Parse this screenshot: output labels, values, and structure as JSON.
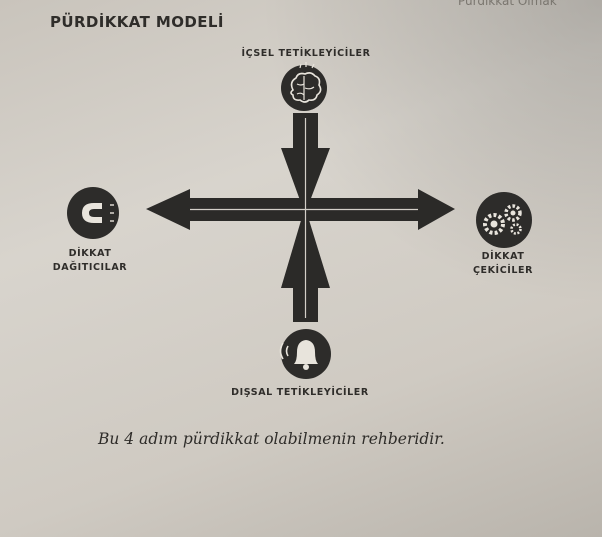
{
  "page": {
    "running_head": "Pürdikkat Olmak",
    "title": "PÜRDİKKAT MODELİ",
    "caption": "Bu 4 adım pürdikkat olabilmenin rehberidir."
  },
  "diagram": {
    "nodes": {
      "top": {
        "label": "İÇSEL TETİKLEYİCİLER",
        "icon": "brain-icon"
      },
      "bottom": {
        "label": "DIŞSAL TETİKLEYİCİLER",
        "icon": "bell-icon"
      },
      "left": {
        "label_line1": "DİKKAT",
        "label_line2": "DAĞITICILAR",
        "icon": "magnet-icon"
      },
      "right": {
        "label_line1": "DİKKAT",
        "label_line2": "ÇEKİCİLER",
        "icon": "gears-icon"
      }
    },
    "colors": {
      "ink": "#2b2a28",
      "paper": "#d3cfc8",
      "icon_fill": "#2d2c2a",
      "icon_line": "#e8e4dc"
    }
  }
}
